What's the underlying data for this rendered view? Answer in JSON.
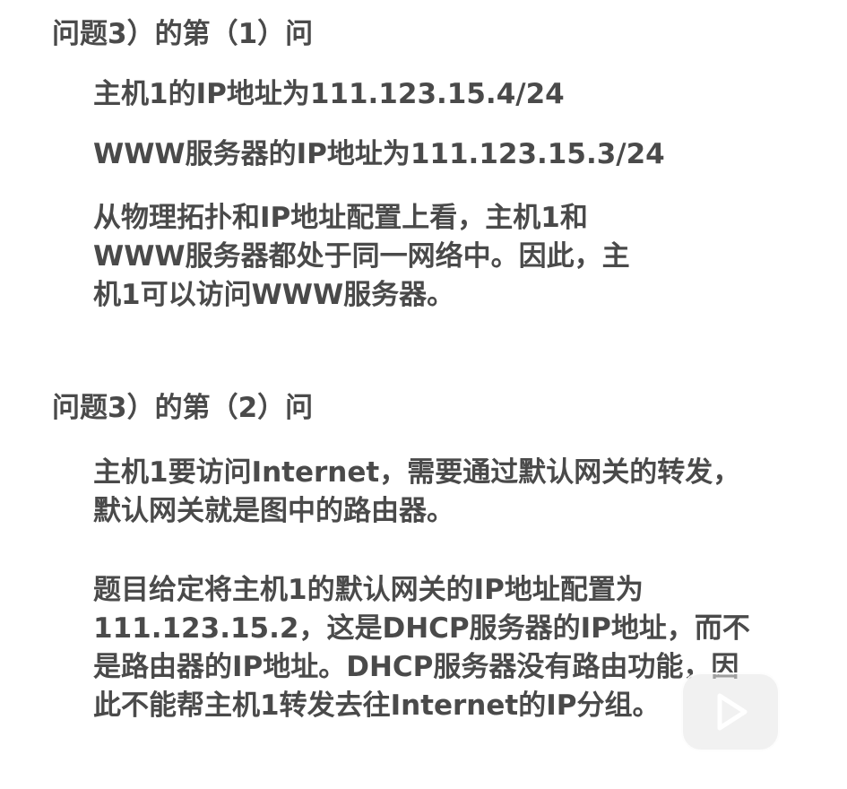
{
  "section1": {
    "heading": "问题3）的第（1）问",
    "p1": "主机1的IP地址为111.123.15.4/24",
    "p2": "WWW服务器的IP地址为111.123.15.3/24",
    "p3_lines": [
      "从物理拓扑和IP地址配置上看，主机1和",
      "WWW服务器都处于同一网络中。因此，主",
      "机1可以访问WWW服务器。"
    ]
  },
  "section2": {
    "heading": "问题3）的第（2）问",
    "p1_lines": [
      "主机1要访问Internet，需要通过默认网关的转发，",
      "默认网关就是图中的路由器。"
    ],
    "p2_lines": [
      "题目给定将主机1的默认网关的IP地址配置为",
      "111.123.15.2，这是DHCP服务器的IP地址，而不",
      "是路由器的IP地址。DHCP服务器没有路由功能，因",
      "此不能帮主机1转发去往Internet的IP分组。"
    ]
  },
  "overlay": {
    "icon": "play-icon",
    "color": "#ffffff"
  }
}
